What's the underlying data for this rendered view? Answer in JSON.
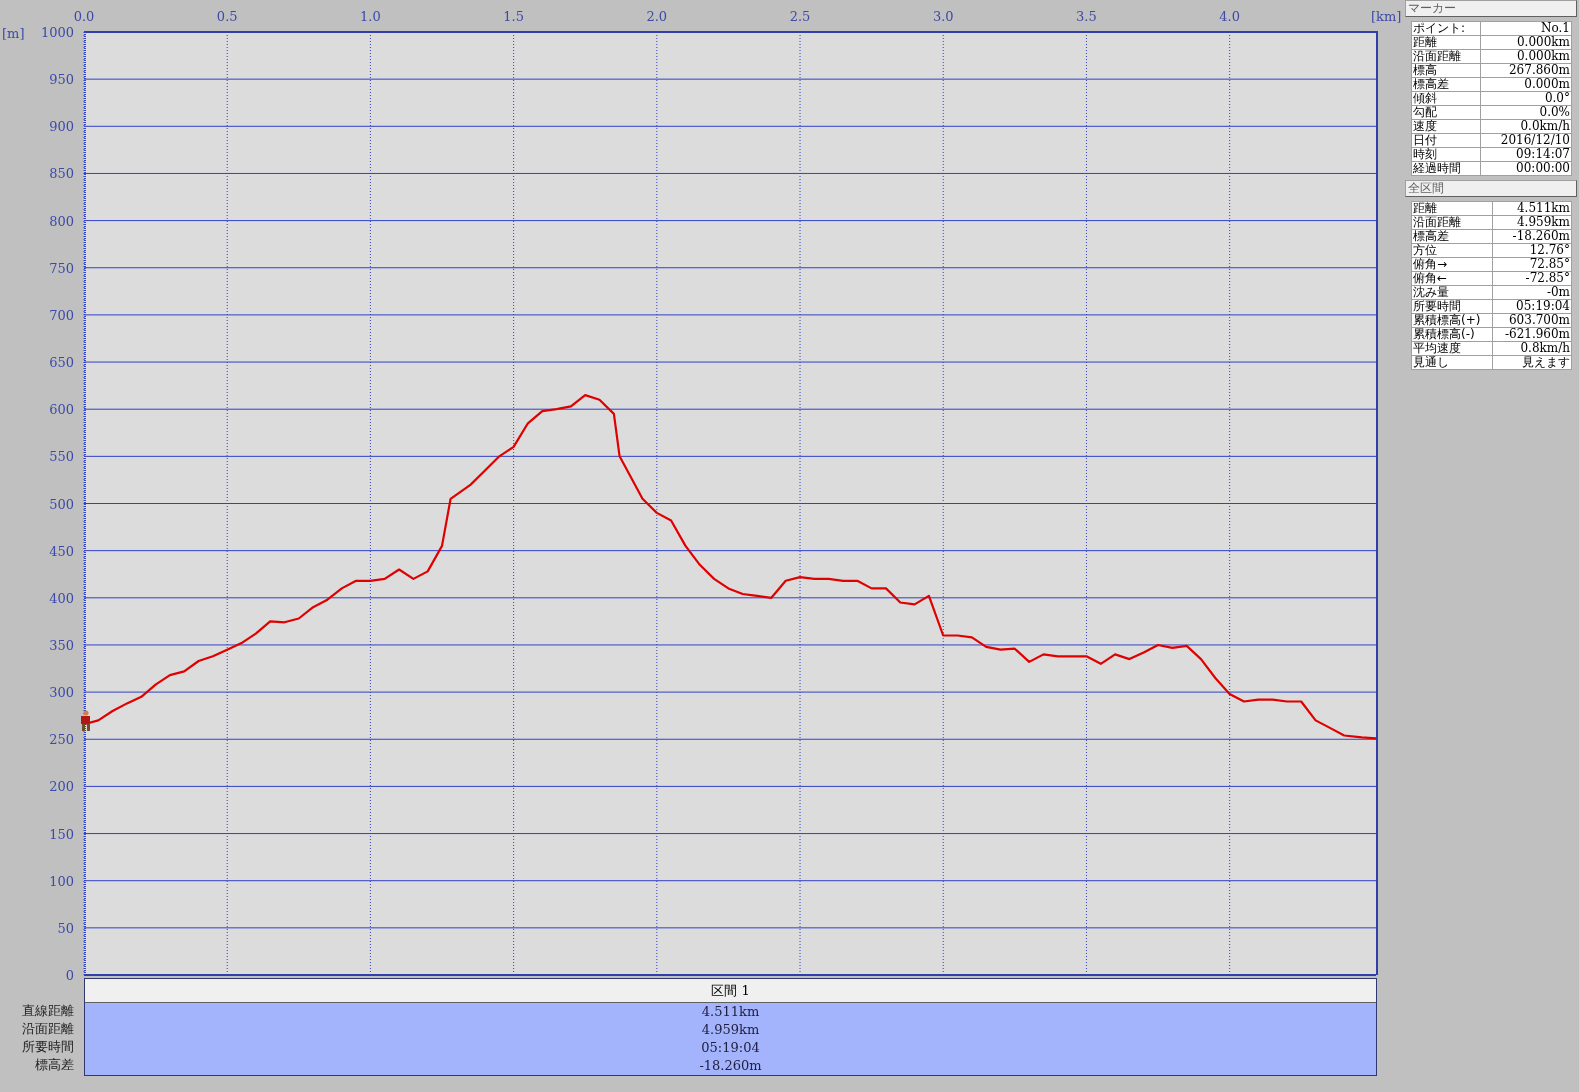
{
  "chart": {
    "chart_data": {
      "type": "line",
      "xlabel": "[km]",
      "ylabel": "[m]",
      "grid": true,
      "x": [
        0,
        0.05,
        0.1,
        0.15,
        0.2,
        0.25,
        0.3,
        0.35,
        0.4,
        0.45,
        0.5,
        0.55,
        0.6,
        0.65,
        0.7,
        0.75,
        0.8,
        0.85,
        0.9,
        0.95,
        1.0,
        1.05,
        1.1,
        1.15,
        1.2,
        1.25,
        1.28,
        1.35,
        1.4,
        1.45,
        1.5,
        1.55,
        1.6,
        1.65,
        1.7,
        1.75,
        1.8,
        1.85,
        1.87,
        1.95,
        2.0,
        2.05,
        2.1,
        2.15,
        2.2,
        2.25,
        2.3,
        2.35,
        2.4,
        2.45,
        2.5,
        2.55,
        2.6,
        2.65,
        2.7,
        2.75,
        2.8,
        2.85,
        2.9,
        2.95,
        3.0,
        3.05,
        3.1,
        3.15,
        3.2,
        3.25,
        3.3,
        3.35,
        3.4,
        3.45,
        3.5,
        3.55,
        3.6,
        3.65,
        3.7,
        3.75,
        3.8,
        3.85,
        3.9,
        3.95,
        4.0,
        4.05,
        4.1,
        4.15,
        4.2,
        4.25,
        4.3,
        4.35,
        4.4,
        4.461,
        4.511
      ],
      "series": [
        {
          "color": "#e00000",
          "values": [
            266,
            270,
            280,
            288,
            295,
            308,
            318,
            322,
            333,
            338,
            345,
            352,
            362,
            375,
            374,
            378,
            390,
            398,
            410,
            418,
            418,
            420,
            430,
            420,
            428,
            455,
            505,
            520,
            535,
            550,
            560,
            585,
            598,
            600,
            603,
            615,
            610,
            595,
            550,
            505,
            490,
            482,
            455,
            435,
            420,
            410,
            404,
            402,
            400,
            418,
            422,
            420,
            420,
            418,
            418,
            410,
            410,
            395,
            393,
            402,
            360,
            360,
            358,
            348,
            345,
            346,
            332,
            340,
            338,
            338,
            338,
            330,
            340,
            335,
            342,
            350,
            347,
            349,
            335,
            315,
            298,
            290,
            292,
            292,
            290,
            290,
            270,
            262,
            254,
            252,
            251
          ]
        }
      ],
      "xlim": [
        0,
        4.511
      ],
      "ylim": [
        0,
        1000
      ],
      "xticks": [
        {
          "value": 0,
          "label": "0.0"
        },
        {
          "value": 0.5,
          "label": "0.5"
        },
        {
          "value": 1,
          "label": "1.0"
        },
        {
          "value": 1.5,
          "label": "1.5"
        },
        {
          "value": 2,
          "label": "2.0"
        },
        {
          "value": 2.5,
          "label": "2.5"
        },
        {
          "value": 3,
          "label": "3.0"
        },
        {
          "value": 3.5,
          "label": "3.5"
        },
        {
          "value": 4,
          "label": "4.0"
        }
      ],
      "yticks": [
        0,
        50,
        100,
        150,
        200,
        250,
        300,
        350,
        400,
        450,
        500,
        550,
        600,
        650,
        700,
        750,
        800,
        850,
        900,
        950,
        1000
      ]
    }
  },
  "section_table": {
    "header": "区間 1",
    "rows": [
      {
        "label": "直線距離",
        "value": "4.511km"
      },
      {
        "label": "沿面距離",
        "value": "4.959km"
      },
      {
        "label": "所要時間",
        "value": "05:19:04"
      },
      {
        "label": "標高差",
        "value": "-18.260m"
      }
    ]
  },
  "marker_panel": {
    "title": "マーカー",
    "rows": [
      {
        "label": "ポイント:",
        "value": "No.1"
      },
      {
        "label": "距離",
        "value": "0.000km"
      },
      {
        "label": "沿面距離",
        "value": "0.000km"
      },
      {
        "label": "標高",
        "value": "267.860m"
      },
      {
        "label": "標高差",
        "value": "0.000m"
      },
      {
        "label": "傾斜",
        "value": "0.0°"
      },
      {
        "label": "勾配",
        "value": "0.0%"
      },
      {
        "label": "速度",
        "value": "0.0km/h"
      },
      {
        "label": "日付",
        "value": "2016/12/10"
      },
      {
        "label": "時刻",
        "value": "09:14:07"
      },
      {
        "label": "経過時間",
        "value": "00:00:00"
      }
    ]
  },
  "total_panel": {
    "title": "全区間",
    "rows": [
      {
        "label": "距離",
        "value": "4.511km"
      },
      {
        "label": "沿面距離",
        "value": "4.959km"
      },
      {
        "label": "標高差",
        "value": "-18.260m"
      },
      {
        "label": "方位",
        "value": "12.76°"
      },
      {
        "label": "俯角→",
        "value": "72.85°"
      },
      {
        "label": "俯角←",
        "value": "-72.85°"
      },
      {
        "label": "沈み量",
        "value": "-0m"
      },
      {
        "label": "所要時間",
        "value": "05:19:04"
      },
      {
        "label": "累積標高(+)",
        "value": "603.700m"
      },
      {
        "label": "累積標高(-)",
        "value": "-621.960m"
      },
      {
        "label": "平均速度",
        "value": "0.8km/h"
      },
      {
        "label": "見通し",
        "value": "見えます"
      }
    ]
  }
}
